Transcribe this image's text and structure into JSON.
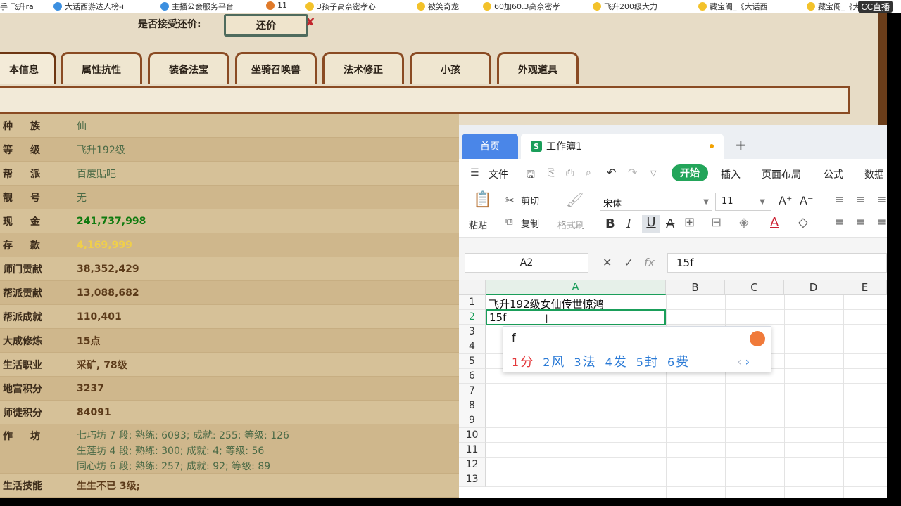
{
  "bookmarks": [
    {
      "label": "手 飞升ra",
      "icon": "tab-fragment-icon"
    },
    {
      "label": "大话西游达人榜-i",
      "icon": "sogou-icon"
    },
    {
      "label": "主播公会服务平台",
      "icon": "cc-icon"
    },
    {
      "label": "11",
      "icon": "game-icon"
    },
    {
      "label": "3孩子高奈密孝心",
      "icon": "star-icon"
    },
    {
      "label": "被笑奇龙",
      "icon": "star-icon"
    },
    {
      "label": "60加60.3高奈密孝",
      "icon": "star-icon"
    },
    {
      "label": "飞升200级大力",
      "icon": "star-icon"
    },
    {
      "label": "藏宝阁_《大话西",
      "icon": "star-icon"
    },
    {
      "label": "藏宝阁_《大话",
      "icon": "star-icon"
    }
  ],
  "stream_logo": "CC直播",
  "game": {
    "offer_label": "是否接受还价:",
    "offer_button": "还价",
    "offer_mark": "✘",
    "tabs": [
      "本信息",
      "属性抗性",
      "装备法宝",
      "坐骑召唤兽",
      "法术修正",
      "小孩",
      "外观道具"
    ],
    "rows": [
      {
        "label": "种族",
        "value": "仙",
        "style": "normal"
      },
      {
        "label": "等级",
        "value": "飞升192级",
        "style": "normal"
      },
      {
        "label": "帮派",
        "value": "百度贴吧",
        "style": "normal"
      },
      {
        "label": "靓号",
        "value": "无",
        "style": "normal"
      },
      {
        "label": "现金",
        "value": "241,737,998",
        "style": "money"
      },
      {
        "label": "存款",
        "value": "4,169,999",
        "style": "gold"
      },
      {
        "label": "师门贡献",
        "value": "38,352,429",
        "style": "brown"
      },
      {
        "label": "帮派贡献",
        "value": "13,088,682",
        "style": "brown"
      },
      {
        "label": "帮派成就",
        "value": "110,401",
        "style": "brown"
      },
      {
        "label": "大成修炼",
        "value": "15点",
        "style": "brown"
      },
      {
        "label": "生活职业",
        "value": "采矿, 78级",
        "style": "brown"
      },
      {
        "label": "地宫积分",
        "value": "3237",
        "style": "brown"
      },
      {
        "label": "师徒积分",
        "value": "84091",
        "style": "brown"
      }
    ],
    "workshop_label": "作坊",
    "workshop_lines": [
      "七巧坊 7 段; 熟练: 6093; 成就: 255; 等级: 126",
      "生莲坊 4 段; 熟练: 300; 成就: 4; 等级: 56",
      "同心坊 6 段; 熟练: 257; 成就: 92; 等级: 89"
    ],
    "life_skill_label": "生活技能",
    "life_skill_value": "生生不已 3级;"
  },
  "spreadsheet": {
    "home_tab": "首页",
    "doc_tab": "工作簿1",
    "doc_icon_letter": "S",
    "new_tab": "+",
    "menu": {
      "file": "文件",
      "start": "开始",
      "insert": "插入",
      "layout": "页面布局",
      "formula": "公式",
      "data": "数据"
    },
    "ribbon": {
      "paste": "粘贴",
      "cut": "剪切",
      "copy": "复制",
      "format_painter": "格式刷",
      "font": "宋体",
      "size": "11"
    },
    "name_box": "A2",
    "formula_value": "15f",
    "columns": [
      "A",
      "B",
      "C",
      "D",
      "E"
    ],
    "row_numbers": [
      "1",
      "2",
      "3",
      "4",
      "5",
      "6",
      "7",
      "8",
      "9",
      "10",
      "11",
      "12",
      "13"
    ],
    "cell_a1": "飞升192级女仙传世惊鸿",
    "cell_a2": "15f",
    "ime": {
      "input": "f",
      "candidates": [
        {
          "n": "1",
          "c": "分"
        },
        {
          "n": "2",
          "c": "风"
        },
        {
          "n": "3",
          "c": "法"
        },
        {
          "n": "4",
          "c": "发"
        },
        {
          "n": "5",
          "c": "封"
        },
        {
          "n": "6",
          "c": "费"
        }
      ]
    }
  }
}
